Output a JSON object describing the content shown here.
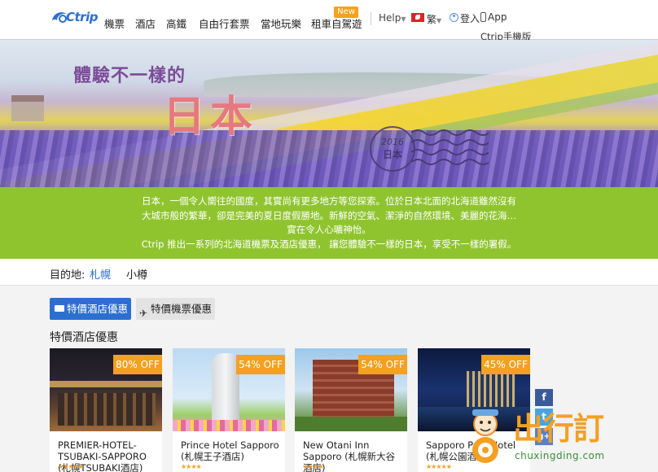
{
  "header": {
    "logo_text": "Ctrip",
    "nav": [
      "機票",
      "酒店",
      "高鐵",
      "自由行套票",
      "當地玩樂",
      "租車自駕遊"
    ],
    "new_badge": "New",
    "help": "Help",
    "lang": "繁",
    "login": "登入",
    "app": "App",
    "app_sub": "Ctrip手機版"
  },
  "banner": {
    "title": "體驗不一樣的",
    "main": "日本",
    "stamp_year": "2016",
    "stamp_text": "日本"
  },
  "intro": {
    "lines": [
      "日本，一個令人嚮往的國度，其實尚有更多地方等您探索。位於日本北面的北海道雖然沒有",
      "大城市般的繁華，卻是完美的夏日度假勝地。新鮮的空氣、潔淨的自然環境、美麗的花海…",
      "實在令人心曠神怡。",
      "Ctrip 推出一系列的北海道機票及酒店優惠， 讓您體驗不一樣的日本，享受不一樣的署假。"
    ]
  },
  "destination": {
    "label": "目的地:",
    "options": [
      "札幌",
      "小樽"
    ],
    "selected": "札幌"
  },
  "tabs": {
    "hotel": "特價酒店優惠",
    "flight": "特價機票優惠"
  },
  "section_title": "特價酒店優惠",
  "hotels": [
    {
      "discount": "80% OFF",
      "name": "PREMIER-HOTEL-TSUBAKI-SAPPORO (札幌TSUBAKI酒店)",
      "stars": "★★★★★"
    },
    {
      "discount": "54% OFF",
      "name": "Prince Hotel Sapporo (札幌王子酒店)",
      "stars": "★★★★"
    },
    {
      "discount": "54% OFF",
      "name": "New Otani Inn Sapporo (札幌新大谷酒店)",
      "stars": "★★★★"
    },
    {
      "discount": "45% OFF",
      "name": "Sapporo Park Hotel (札幌公園酒店)",
      "stars": "★★★★★"
    }
  ],
  "social": [
    "f",
    "t",
    "g+"
  ],
  "watermark": {
    "text": "出行訂",
    "url": "chuxingding.com"
  },
  "colors": {
    "brand_blue": "#2b6fd1",
    "intro_green": "#8fc42f",
    "discount_orange": "#f3a023"
  }
}
